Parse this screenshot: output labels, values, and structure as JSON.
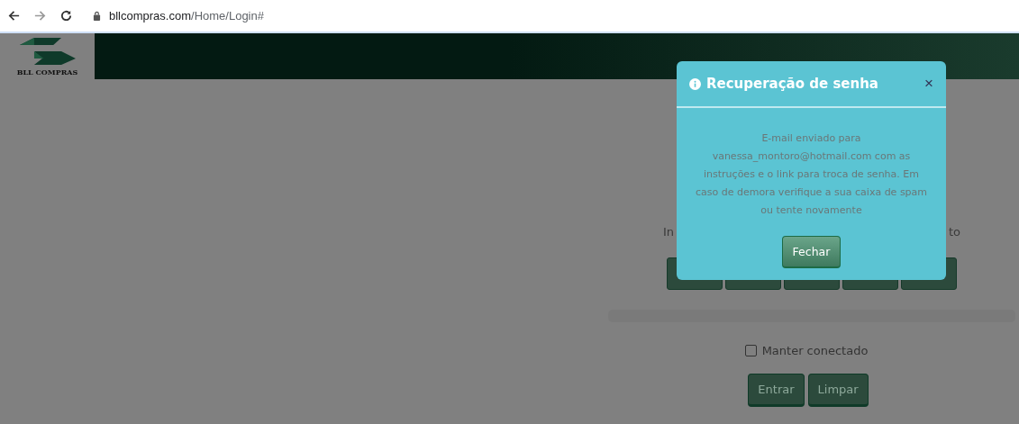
{
  "browser": {
    "url_host": "bllcompras.com",
    "url_path": "/Home/Login#"
  },
  "header": {
    "logo_text": "BLL COMPRAS"
  },
  "login": {
    "hidden_label_fragments": [
      "In",
      "to"
    ],
    "remember": {
      "label": "Manter conectado",
      "checked": false
    },
    "buttons": [
      "Entrar",
      "Limpar"
    ]
  },
  "modal": {
    "title": "Recuperação de senha",
    "close": "×",
    "message": "E-mail enviado para vanessa_montoro@hotmail.com com as instruções e o link para troca de senha. Em caso de demora verifique a sua caixa de spam ou tente novamente",
    "button": "Fechar"
  }
}
